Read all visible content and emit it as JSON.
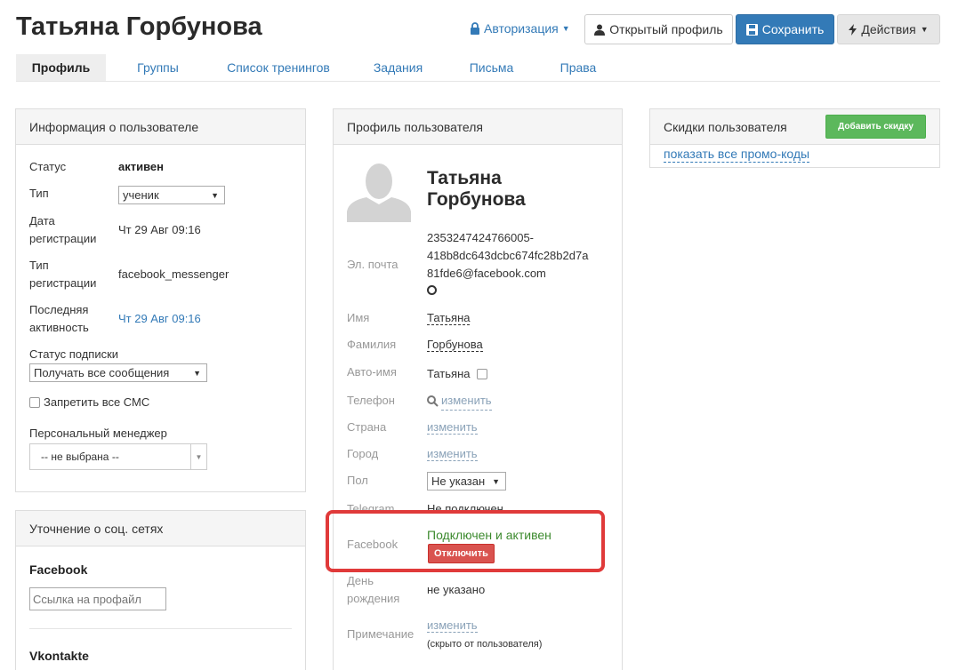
{
  "header": {
    "title": "Татьяна Горбунова",
    "auth_link": "Авторизация",
    "open_profile": "Открытый профиль",
    "save": "Сохранить",
    "actions": "Действия"
  },
  "tabs": [
    {
      "label": "Профиль",
      "active": true
    },
    {
      "label": "Группы"
    },
    {
      "label": "Список тренингов"
    },
    {
      "label": "Задания"
    },
    {
      "label": "Письма"
    },
    {
      "label": "Права"
    }
  ],
  "user_info": {
    "title": "Информация о пользователе",
    "status_label": "Статус",
    "status_value": "активен",
    "type_label": "Тип",
    "type_value": "ученик",
    "reg_date_label_1": "Дата",
    "reg_date_label_2": "регистрации",
    "reg_date_value": "Чт 29 Авг 09:16",
    "reg_type_label_1": "Тип",
    "reg_type_label_2": "регистрации",
    "reg_type_value": "facebook_messenger",
    "last_active_label_1": "Последняя",
    "last_active_label_2": "активность",
    "last_active_value": "Чт 29 Авг 09:16",
    "subscription_label": "Статус подписки",
    "subscription_value": "Получать все сообщения",
    "sms_label": "Запретить все СМС",
    "manager_label": "Персональный менеджер",
    "manager_value": "-- не выбрана --"
  },
  "social": {
    "title": "Уточнение о соц. сетях",
    "facebook_label": "Facebook",
    "facebook_placeholder": "Ссылка на профайл",
    "vk_label": "Vkontakte"
  },
  "profile": {
    "title": "Профиль пользователя",
    "name_line1": "Татьяна",
    "name_line2": "Горбунова",
    "email_label": "Эл. почта",
    "email_line1": "2353247424766005-",
    "email_line2": "418b8dc643dcbc674fc28b2d7a",
    "email_line3": "81fde6@facebook.com",
    "first_name_label": "Имя",
    "first_name_value": "Татьяна",
    "last_name_label": "Фамилия",
    "last_name_value": "Горбунова",
    "auto_name_label": "Авто-имя",
    "auto_name_value": "Татьяна",
    "phone_label": "Телефон",
    "phone_value": "изменить",
    "country_label": "Страна",
    "country_value": "изменить",
    "city_label": "Город",
    "city_value": "изменить",
    "gender_label": "Пол",
    "gender_value": "Не указан",
    "telegram_label": "Telegram",
    "telegram_value": "Не подключен",
    "facebook_label": "Facebook",
    "facebook_value": "Подключен и активен",
    "disconnect": "Отключить",
    "birthday_label_1": "День",
    "birthday_label_2": "рождения",
    "birthday_value": "не указано",
    "note_label": "Примечание",
    "note_value": "изменить",
    "note_hint": "(скрыто от пользователя)"
  },
  "discounts": {
    "title": "Скидки пользователя",
    "add_button": "Добавить скидку",
    "show_codes": "показать все промо-коды"
  },
  "colors": {
    "primary": "#337ab7",
    "success": "#5cb85c",
    "danger": "#d9534f",
    "highlight": "#e03a3a",
    "connected_text": "#3c8a2e"
  }
}
